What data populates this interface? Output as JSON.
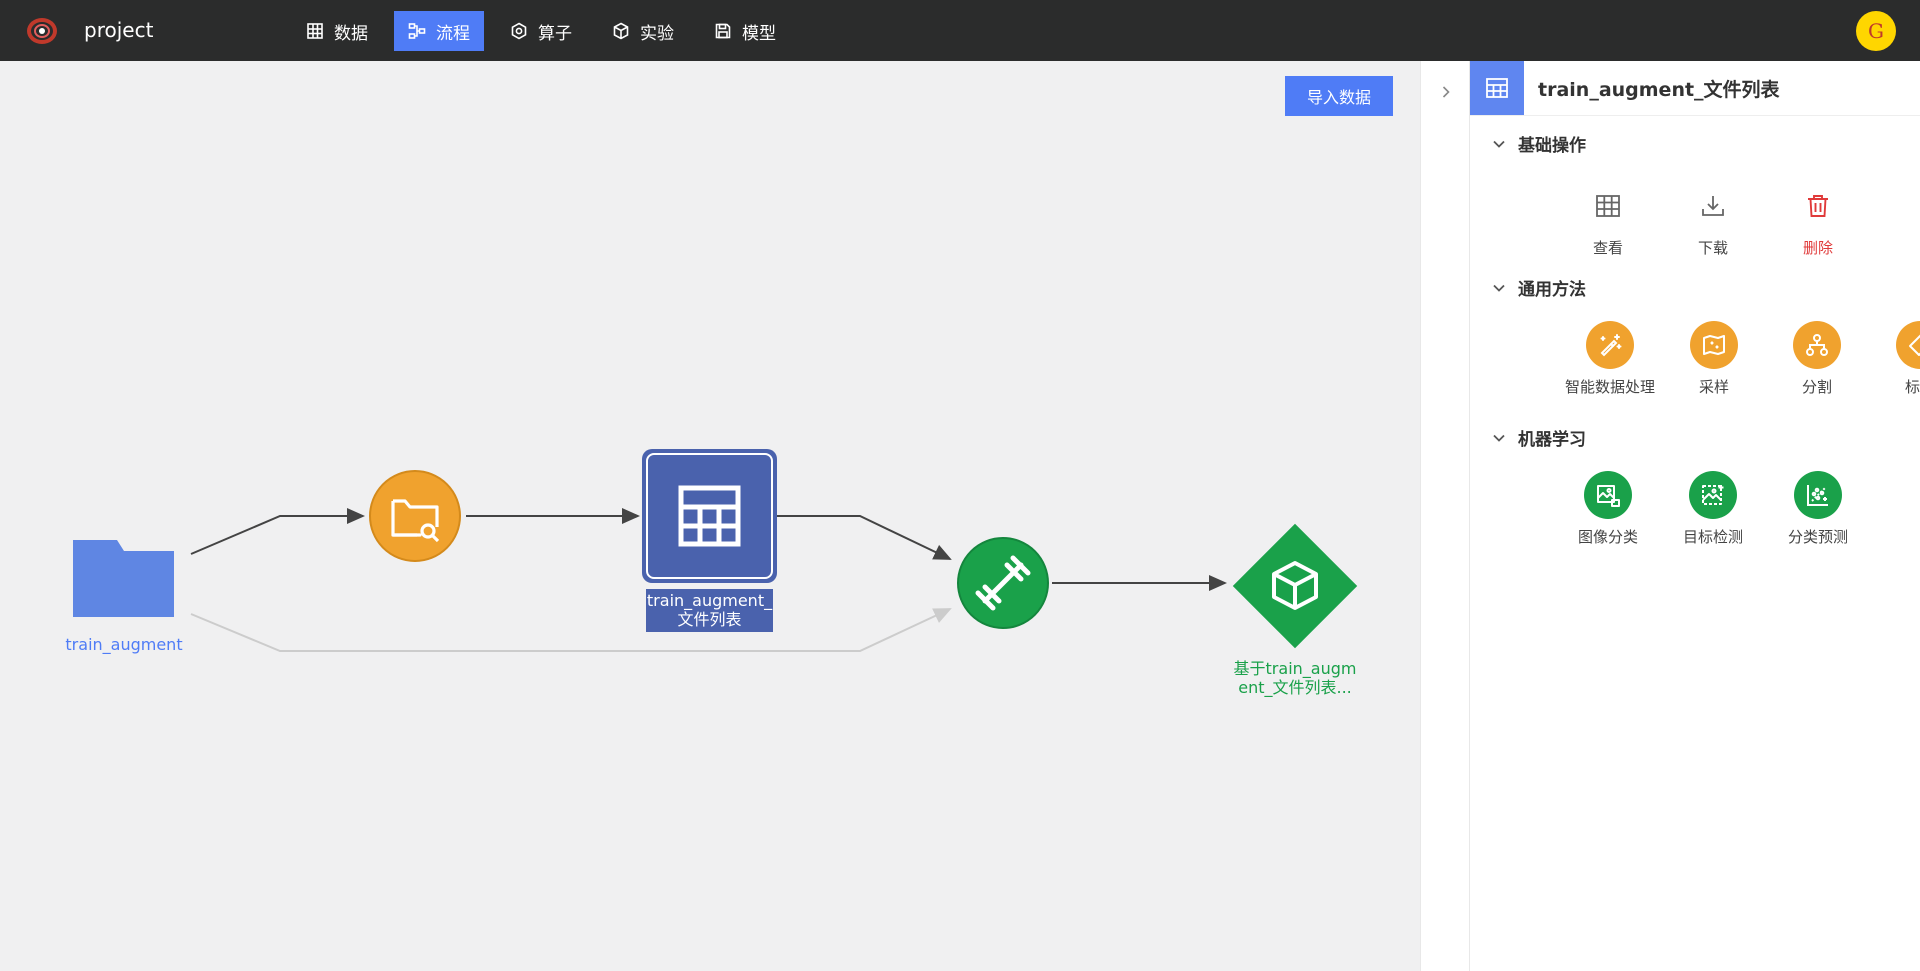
{
  "app": {
    "project_name": "project"
  },
  "nav": {
    "items": [
      {
        "label": "数据",
        "icon": "table-icon",
        "active": false
      },
      {
        "label": "流程",
        "icon": "flow-icon",
        "active": true
      },
      {
        "label": "算子",
        "icon": "hexagon-icon",
        "active": false
      },
      {
        "label": "实验",
        "icon": "cube-icon",
        "active": false
      },
      {
        "label": "模型",
        "icon": "save-icon",
        "active": false
      }
    ]
  },
  "user": {
    "avatar_letter": "G",
    "avatar_color": "#ffd600"
  },
  "canvas": {
    "import_button": "导入数据",
    "nodes": {
      "dataset": {
        "label": "train_augment",
        "color": "#5f86e3"
      },
      "scan": {
        "color": "#f0a22e"
      },
      "filelist": {
        "label_line1": "train_augment_",
        "label_line2": "文件列表",
        "color": "#4a62ad"
      },
      "train": {
        "color": "#1aa14a"
      },
      "model": {
        "label_line1": "基于train_augm",
        "label_line2": "ent_文件列表...",
        "color": "#1aa14a"
      }
    }
  },
  "panel": {
    "title": "train_augment_文件列表",
    "sections": [
      {
        "title": "基础操作",
        "items": [
          {
            "label": "查看",
            "icon": "table-icon"
          },
          {
            "label": "下载",
            "icon": "download-icon"
          },
          {
            "label": "删除",
            "icon": "trash-icon",
            "color": "#e03a3a"
          }
        ]
      },
      {
        "title": "通用方法",
        "items": [
          {
            "label": "智能数据处理",
            "icon": "magic-wand-icon"
          },
          {
            "label": "采样",
            "icon": "map-icon"
          },
          {
            "label": "分割",
            "icon": "split-icon"
          },
          {
            "label": "标注",
            "icon": "tag-icon"
          }
        ]
      },
      {
        "title": "机器学习",
        "items": [
          {
            "label": "图像分类",
            "icon": "image-classify-icon"
          },
          {
            "label": "目标检测",
            "icon": "object-detect-icon"
          },
          {
            "label": "分类预测",
            "icon": "scatter-chart-icon"
          }
        ]
      }
    ]
  }
}
